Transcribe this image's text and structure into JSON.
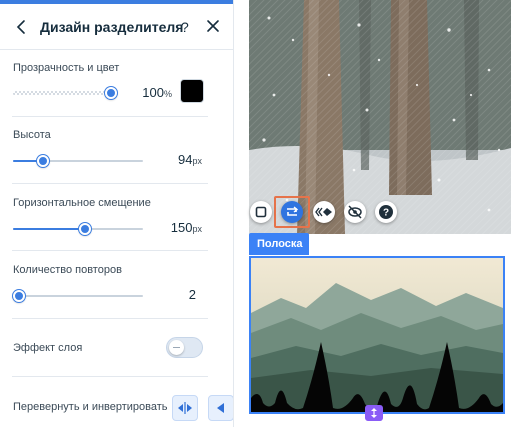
{
  "panel": {
    "title": "Дизайн разделителя",
    "help": "?",
    "sections": {
      "opacity": {
        "label": "Прозрачность и цвет",
        "value": "100",
        "unit": "%",
        "fraction": 1.0,
        "color": "#000000"
      },
      "height": {
        "label": "Высота",
        "value": "94",
        "unit": "px",
        "fraction": 0.23
      },
      "offset": {
        "label": "Горизонтальное смещение",
        "value": "150",
        "unit": "px",
        "fraction": 0.55
      },
      "repeats": {
        "label": "Количество повторов",
        "value": "2",
        "fraction": 0.0
      },
      "layer_effect": {
        "label": "Эффект слоя",
        "enabled": false
      },
      "flip": {
        "label": "Перевернуть и инвертировать"
      }
    }
  },
  "canvas": {
    "strip_label": "Полоска",
    "toolbar": [
      "square-frame-icon",
      "divider-swap-icon",
      "shape-arrows-icon",
      "hide-eye-icon",
      "help-icon"
    ],
    "accent": "#3b82f6",
    "highlight": "#e6734a",
    "handle_color": "#8a5cf6"
  }
}
